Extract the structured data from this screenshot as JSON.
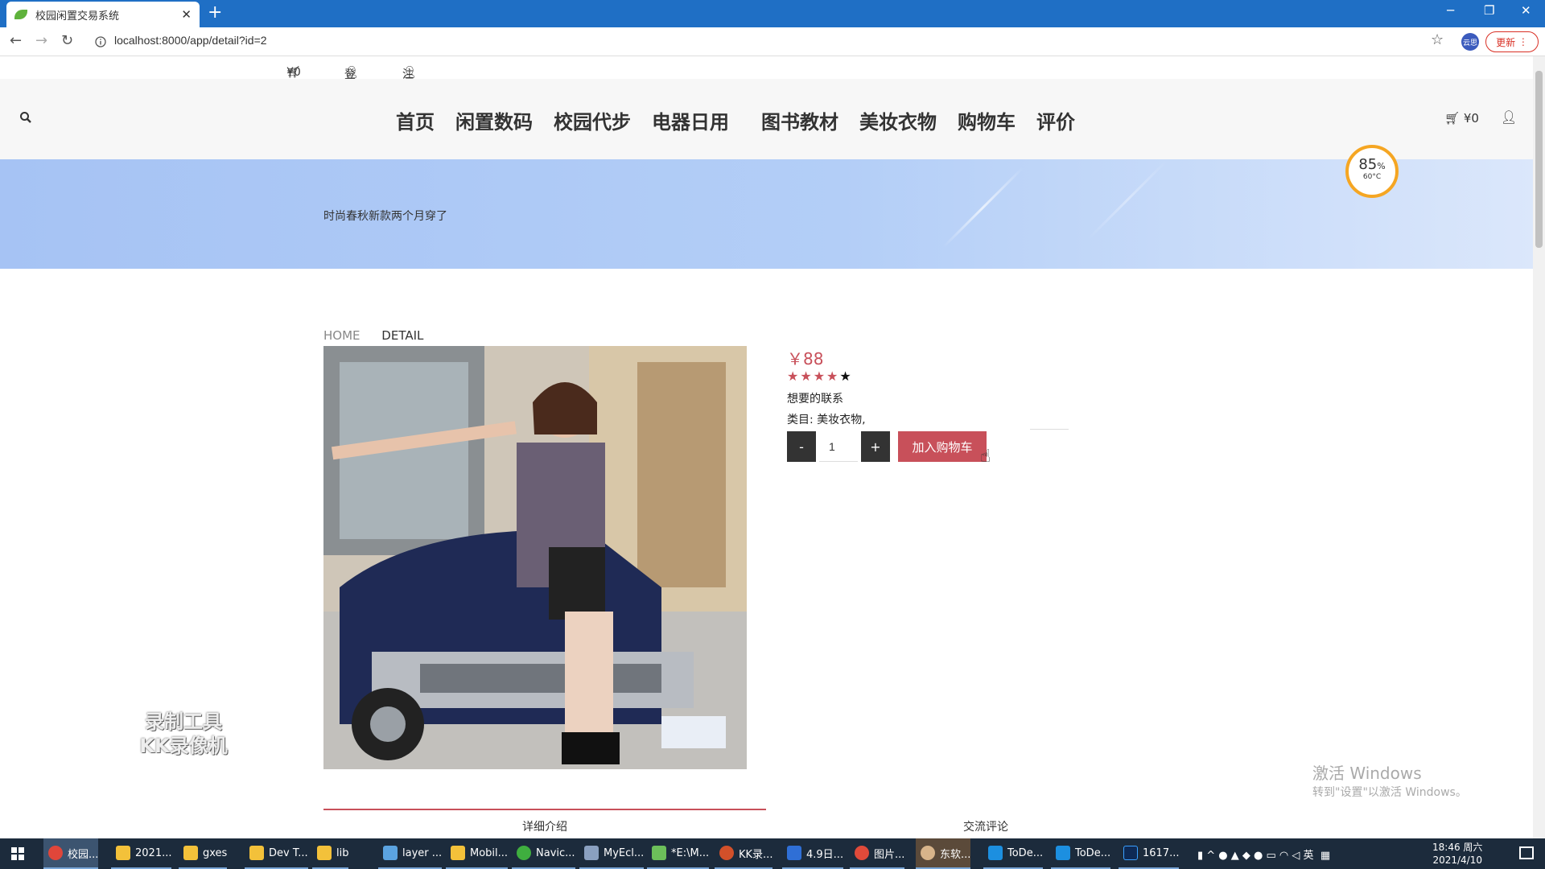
{
  "browser": {
    "tab_title": "校园闲置交易系统",
    "new_tab_label": "+",
    "url": "localhost:8000/app/detail?id=2",
    "update_label": "更新",
    "profile_label": "云思"
  },
  "topbar": {
    "cart": "¥0",
    "login": "登录",
    "register": "注册"
  },
  "nav": {
    "items": [
      "首页",
      "闲置数码",
      "校园代步",
      "电器日用",
      "图书教材",
      "美妆衣物",
      "购物车",
      "评价"
    ],
    "cart": "¥0"
  },
  "banner": {
    "slogan": "时尚春秋新款两个月穿了"
  },
  "gauge": {
    "percent": "85",
    "percent_unit": "%",
    "temp": "60°C"
  },
  "breadcrumb": {
    "home": "HOME",
    "current": "DETAIL"
  },
  "product": {
    "price": "￥88",
    "rating": 4,
    "rating_max": 5,
    "description": "想要的联系",
    "category": "类目: 美妆衣物,",
    "quantity": "1",
    "minus_label": "-",
    "plus_label": "+",
    "add_to_cart_label": "加入购物车",
    "accent_color": "#c8505a"
  },
  "tabs": {
    "detail": "详细介绍",
    "comments": "交流评论"
  },
  "watermarks": {
    "recorder_line1": "录制工具",
    "recorder_line2": "KK录像机",
    "activate_line1": "激活 Windows",
    "activate_line2": "转到\"设置\"以激活 Windows。"
  },
  "taskbar": {
    "items": [
      "校园...",
      "2021...",
      "gxes",
      "Dev T...",
      "lib",
      "layer ...",
      "Mobil...",
      "Navic...",
      "MyEcl...",
      "*E:\\M...",
      "KK录...",
      "4.9日...",
      "图片...",
      "东软...",
      "ToDe...",
      "ToDe...",
      "1617..."
    ],
    "ime": "英",
    "time": "18:46 周六",
    "date": "2021/4/10"
  }
}
